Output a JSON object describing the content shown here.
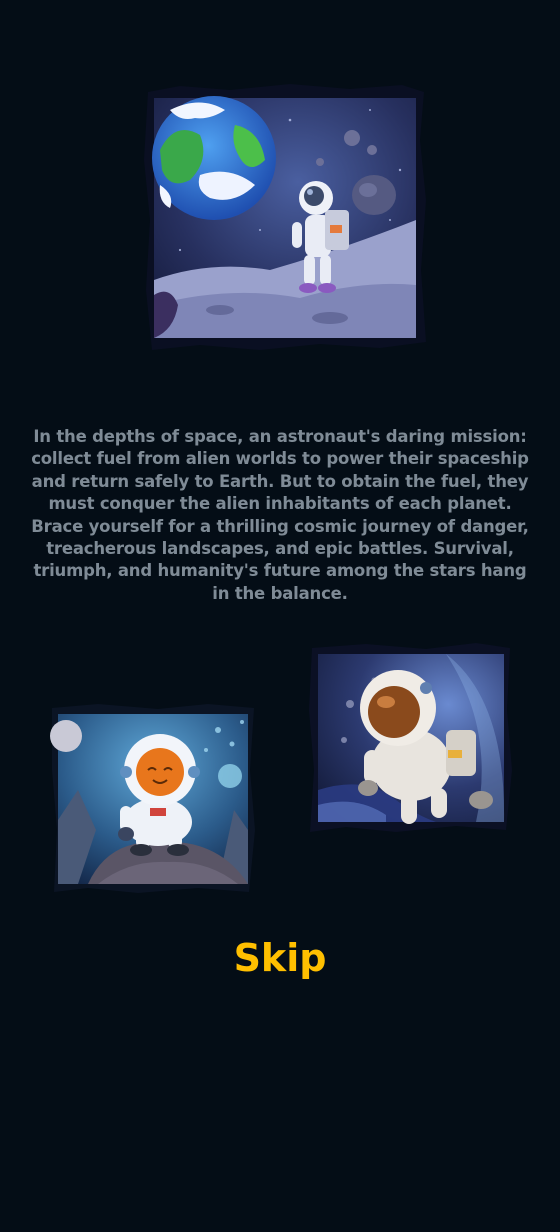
{
  "screen": "intro-story",
  "theme": {
    "background": "#040d16",
    "story_text_color": "#7f8b96",
    "skip_color": "#ffbf00"
  },
  "illustrations": [
    {
      "name": "astronaut-on-moon-with-earth-illustration"
    },
    {
      "name": "astronaut-floating-in-space-illustration"
    },
    {
      "name": "smiling-astronaut-sitting-on-rock-illustration"
    }
  ],
  "story": {
    "text": "In the depths of space, an astronaut's daring mission: collect fuel from alien worlds to power their spaceship and return safely to Earth. But to obtain the fuel, they must conquer the alien inhabitants of each planet. Brace yourself for a thrilling cosmic journey of danger, treacherous landscapes, and epic battles. Survival, triumph, and humanity's future among the stars hang in the balance."
  },
  "actions": {
    "skip_label": "Skip"
  }
}
